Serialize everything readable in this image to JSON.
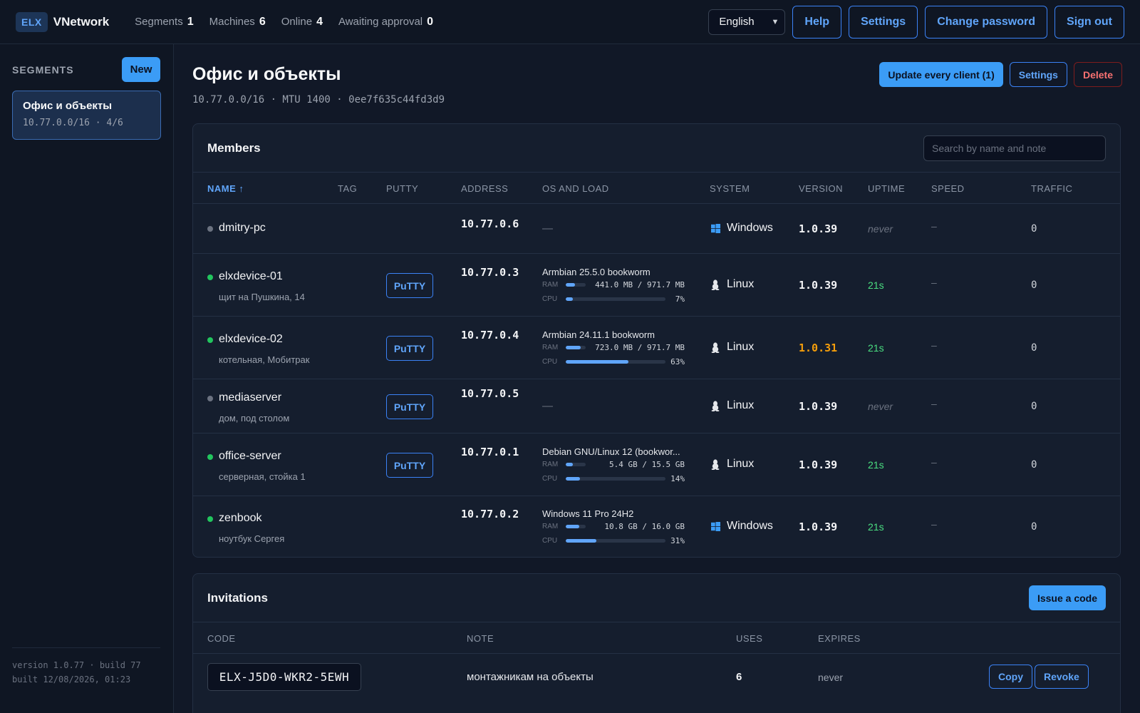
{
  "header": {
    "logo_badge": "ELX",
    "app_name": "VNetwork",
    "stats": [
      {
        "label": "Segments",
        "value": "1"
      },
      {
        "label": "Machines",
        "value": "6"
      },
      {
        "label": "Online",
        "value": "4"
      },
      {
        "label": "Awaiting approval",
        "value": "0"
      }
    ],
    "language": "English",
    "buttons": {
      "help": "Help",
      "settings": "Settings",
      "change_password": "Change password",
      "sign_out": "Sign out"
    }
  },
  "sidebar": {
    "title": "SEGMENTS",
    "new_label": "New",
    "segments": [
      {
        "name": "Офис и объекты",
        "meta": "10.77.0.0/16 · 4/6"
      }
    ],
    "version": "version 1.0.77 · build 77",
    "built": "built 12/08/2026, 01:23"
  },
  "segment": {
    "title": "Офис и объекты",
    "subtitle": "10.77.0.0/16 · MTU 1400 · 0ee7f635c44fd3d9",
    "actions": {
      "update": "Update every client (1)",
      "settings": "Settings",
      "delete": "Delete"
    }
  },
  "members": {
    "title": "Members",
    "search_placeholder": "Search by name and note",
    "columns": [
      "NAME ↑",
      "TAG",
      "PUTTY",
      "ADDRESS",
      "OS AND LOAD",
      "SYSTEM",
      "VERSION",
      "UPTIME",
      "SPEED",
      "TRAFFIC"
    ],
    "rows": [
      {
        "online": false,
        "name": "dmitry-pc",
        "note": "",
        "putty": "",
        "address": "10.77.0.6",
        "os": "—",
        "ram_label": "",
        "ram": "",
        "ram_pct": 0,
        "cpu_label": "",
        "cpu": "",
        "cpu_pct": 0,
        "system": "Windows",
        "system_icon": "windows-icon",
        "version": "1.0.39",
        "version_outdated": false,
        "uptime": "never",
        "speed": "–",
        "traffic": "0"
      },
      {
        "online": true,
        "name": "elxdevice-01",
        "note": "щит на Пушкина, 14",
        "putty": "PuTTY",
        "address": "10.77.0.3",
        "os": "Armbian 25.5.0 bookworm",
        "ram_label": "RAM",
        "ram": "441.0 MB / 971.7 MB",
        "ram_pct": 45,
        "cpu_label": "CPU",
        "cpu": "7%",
        "cpu_pct": 7,
        "system": "Linux",
        "system_icon": "linux-icon",
        "version": "1.0.39",
        "version_outdated": false,
        "uptime": "21s",
        "speed": "–",
        "traffic": "0"
      },
      {
        "online": true,
        "name": "elxdevice-02",
        "note": "котельная, Мобитрак",
        "putty": "PuTTY",
        "address": "10.77.0.4",
        "os": "Armbian 24.11.1 bookworm",
        "ram_label": "RAM",
        "ram": "723.0 MB / 971.7 MB",
        "ram_pct": 74,
        "cpu_label": "CPU",
        "cpu": "63%",
        "cpu_pct": 63,
        "system": "Linux",
        "system_icon": "linux-icon",
        "version": "1.0.31",
        "version_outdated": true,
        "uptime": "21s",
        "speed": "–",
        "traffic": "0"
      },
      {
        "online": false,
        "name": "mediaserver",
        "note": "дом, под столом",
        "putty": "PuTTY",
        "address": "10.77.0.5",
        "os": "—",
        "ram_label": "",
        "ram": "",
        "ram_pct": 0,
        "cpu_label": "",
        "cpu": "",
        "cpu_pct": 0,
        "system": "Linux",
        "system_icon": "linux-icon",
        "version": "1.0.39",
        "version_outdated": false,
        "uptime": "never",
        "speed": "–",
        "traffic": "0"
      },
      {
        "online": true,
        "name": "office-server",
        "note": "серверная, стойка 1",
        "putty": "PuTTY",
        "address": "10.77.0.1",
        "os": "Debian GNU/Linux 12 (bookwor...",
        "ram_label": "RAM",
        "ram": "5.4 GB / 15.5 GB",
        "ram_pct": 35,
        "cpu_label": "CPU",
        "cpu": "14%",
        "cpu_pct": 14,
        "system": "Linux",
        "system_icon": "linux-icon",
        "version": "1.0.39",
        "version_outdated": false,
        "uptime": "21s",
        "speed": "–",
        "traffic": "0"
      },
      {
        "online": true,
        "name": "zenbook",
        "note": "ноутбук Сергея",
        "putty": "",
        "address": "10.77.0.2",
        "os": "Windows 11 Pro 24H2",
        "ram_label": "RAM",
        "ram": "10.8 GB / 16.0 GB",
        "ram_pct": 68,
        "cpu_label": "CPU",
        "cpu": "31%",
        "cpu_pct": 31,
        "system": "Windows",
        "system_icon": "windows-icon",
        "version": "1.0.39",
        "version_outdated": false,
        "uptime": "21s",
        "speed": "–",
        "traffic": "0"
      }
    ]
  },
  "invitations": {
    "title": "Invitations",
    "issue_label": "Issue a code",
    "columns": [
      "CODE",
      "NOTE",
      "USES",
      "EXPIRES"
    ],
    "rows": [
      {
        "code": "ELX-J5D0-WKR2-5EWH",
        "note": "монтажникам на объекты",
        "uses": "6",
        "expires": "never",
        "copy": "Copy",
        "revoke": "Revoke"
      }
    ]
  },
  "colors": {
    "accent": "#3b9cf6",
    "online": "#22c55e",
    "offline": "#6b7280",
    "outdated": "#f59e0b",
    "danger": "#f87171"
  }
}
